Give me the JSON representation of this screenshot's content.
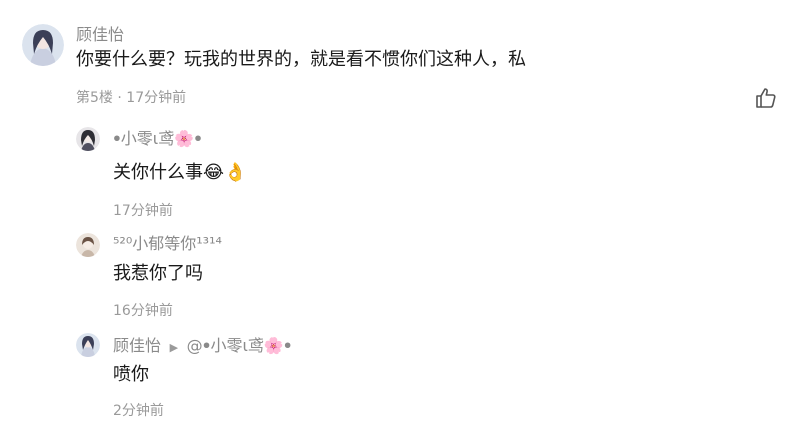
{
  "comment": {
    "author": "顾佳怡",
    "text": "你要什么要？玩我的世界的，就是看不惯你们这种人，私",
    "floor": "第5楼",
    "time": "17分钟前",
    "like_icon": "thumbs-up-icon"
  },
  "replies": [
    {
      "author": "ꔷ小零ι鸢🌸ꔷ",
      "text": "关你什么事😂👌",
      "time": "17分钟前"
    },
    {
      "author": "⁵²⁰小郁等你¹³¹⁴",
      "text": "我惹你了吗",
      "time": "16分钟前"
    },
    {
      "author": "顾佳怡",
      "reply_to": "@ꔷ小零ι鸢🌸ꔷ",
      "text": "喷你",
      "time": "2分钟前"
    }
  ],
  "colors": {
    "name": "#8a8a8a",
    "text": "#1a1a1a",
    "meta": "#9a9a9a"
  }
}
